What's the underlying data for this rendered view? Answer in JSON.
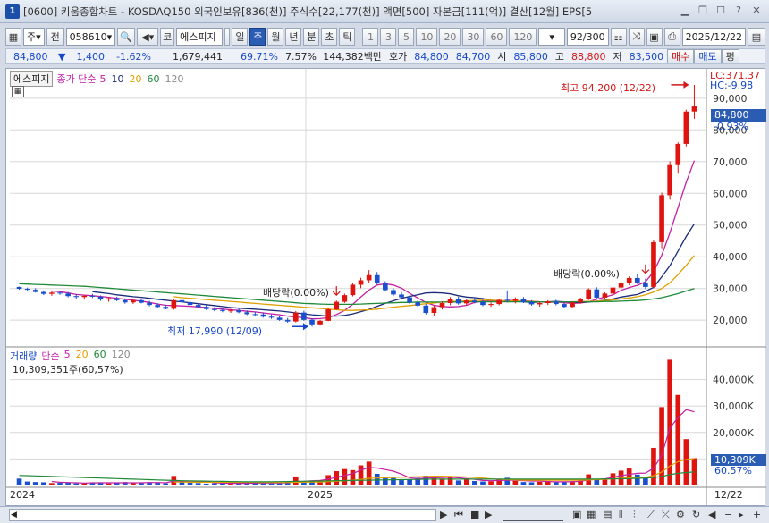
{
  "window": {
    "title": "[0600] 키움종합차트 - KOSDAQ150 외국인보유[836(천)] 주식수[22,177(천)] 액면[500] 자본금[111(억)] 결산[12월] EPS[5",
    "icon_label": "1"
  },
  "toolbar": {
    "period_kind": "주",
    "adj_label": "전",
    "code": "058610",
    "market_label": "코",
    "stock_name": "에스피지",
    "periods": [
      "일",
      "주",
      "월",
      "년",
      "분",
      "초",
      "틱"
    ],
    "selected_period": "주",
    "intervals": [
      "1",
      "3",
      "5",
      "10",
      "20",
      "30",
      "60",
      "120"
    ],
    "count": "92/300",
    "date": "2025/12/22"
  },
  "infobar": {
    "price": "84,800",
    "change_arrow": "▼",
    "change": "1,400",
    "change_pct": "-1.62%",
    "volume": "1,679,441",
    "vol_ratio": "69.71%",
    "turnover": "7.57%",
    "amount": "144,382백만",
    "ask_label": "호가",
    "ask1": "84,800",
    "ask2": "84,700",
    "open_label": "시",
    "open": "85,800",
    "high_label": "고",
    "high": "88,800",
    "low_label": "저",
    "low": "83,500",
    "buy_label": "매수",
    "sell_label": "매도",
    "eval_label": "평"
  },
  "price_legend": {
    "name": "에스피지",
    "ma_label": "종가 단순",
    "periods": [
      "5",
      "10",
      "20",
      "60",
      "120"
    ],
    "colors": [
      "#c41fa2",
      "#1c2a7a",
      "#e0a000",
      "#1f8a3a",
      "#888888"
    ]
  },
  "vol_legend": {
    "name": "거래량",
    "ma_label": "단순",
    "periods": [
      "5",
      "20",
      "60",
      "120"
    ],
    "value_text": "10,309,351주(60,57%)"
  },
  "annotations": {
    "lc": "LC:371.37",
    "hc": "HC:-9.98",
    "high_note": "최고 94,200 (12/22)",
    "low_note": "최저 17,990 (12/09)",
    "div1": "배당락(0.00%)",
    "div2": "배당락(0.00%)",
    "current_price": "84,800",
    "current_pct": "-0.93%",
    "current_vol": "10,309K",
    "current_vol_pct": "60.57%"
  },
  "date_labels": {
    "start": "2024",
    "mid": "2025",
    "end": "12/22"
  },
  "chart_data": {
    "type": "candlestick",
    "price_ylim": [
      13000,
      97000
    ],
    "price_ticks": [
      20000,
      30000,
      40000,
      50000,
      60000,
      70000,
      80000,
      90000
    ],
    "price_tick_labels": [
      "20,000",
      "30,000",
      "40,000",
      "50,000",
      "60,000",
      "70,000",
      "80,000",
      "90,000"
    ],
    "volume_ylim": [
      0,
      50000000
    ],
    "volume_ticks": [
      10000000,
      20000000,
      30000000,
      40000000
    ],
    "volume_tick_labels": [
      "10,000K",
      "20,000K",
      "30,000K",
      "40,000K"
    ],
    "candles": [
      [
        30500,
        30600,
        29600,
        29900
      ],
      [
        29900,
        30300,
        29100,
        29600
      ],
      [
        29600,
        30100,
        28700,
        28900
      ],
      [
        28900,
        29400,
        27900,
        28300
      ],
      [
        28300,
        29100,
        27700,
        28700
      ],
      [
        28700,
        29300,
        28000,
        28400
      ],
      [
        28400,
        28900,
        27200,
        27600
      ],
      [
        27600,
        28200,
        26800,
        27300
      ],
      [
        27300,
        28000,
        26500,
        27700
      ],
      [
        27700,
        28300,
        27000,
        27400
      ],
      [
        27400,
        27800,
        26100,
        26500
      ],
      [
        26500,
        27300,
        25800,
        26900
      ],
      [
        26900,
        27400,
        26000,
        26300
      ],
      [
        26300,
        26900,
        25200,
        25600
      ],
      [
        25600,
        26700,
        25100,
        26300
      ],
      [
        26300,
        26800,
        25300,
        25500
      ],
      [
        25500,
        26100,
        24400,
        24800
      ],
      [
        24800,
        25400,
        23800,
        24200
      ],
      [
        24200,
        24900,
        23400,
        23600
      ],
      [
        23600,
        26800,
        23300,
        26300
      ],
      [
        26300,
        27200,
        25300,
        25700
      ],
      [
        25700,
        26300,
        24500,
        24800
      ],
      [
        24800,
        25300,
        23800,
        24200
      ],
      [
        24200,
        24700,
        23200,
        23500
      ],
      [
        23500,
        24100,
        22800,
        23200
      ],
      [
        23200,
        23800,
        22500,
        22900
      ],
      [
        22900,
        23600,
        22300,
        23100
      ],
      [
        23100,
        23600,
        22200,
        22500
      ],
      [
        22500,
        23100,
        21600,
        21900
      ],
      [
        21900,
        22600,
        21200,
        21800
      ],
      [
        21800,
        22400,
        20800,
        21100
      ],
      [
        21100,
        21800,
        20400,
        20800
      ],
      [
        20800,
        21400,
        19800,
        20100
      ],
      [
        20100,
        20700,
        19200,
        19600
      ],
      [
        19600,
        22900,
        19300,
        22400
      ],
      [
        22400,
        23000,
        19800,
        20100
      ],
      [
        20100,
        20600,
        17990,
        18700
      ],
      [
        18700,
        20100,
        18300,
        19800
      ],
      [
        19800,
        23800,
        19700,
        23400
      ],
      [
        23400,
        26200,
        23200,
        25800
      ],
      [
        25800,
        28400,
        25400,
        27900
      ],
      [
        27900,
        31600,
        27500,
        31200
      ],
      [
        31200,
        33400,
        30100,
        32600
      ],
      [
        32600,
        35800,
        31700,
        34200
      ],
      [
        34200,
        35200,
        31300,
        31800
      ],
      [
        31800,
        32300,
        29200,
        29500
      ],
      [
        29500,
        30100,
        27600,
        28100
      ],
      [
        28100,
        28900,
        26800,
        27200
      ],
      [
        27200,
        27800,
        25100,
        25600
      ],
      [
        25600,
        26200,
        24200,
        24600
      ],
      [
        24600,
        25100,
        21800,
        22300
      ],
      [
        22300,
        24600,
        21500,
        24100
      ],
      [
        24100,
        25900,
        23400,
        25400
      ],
      [
        25400,
        27300,
        24700,
        26800
      ],
      [
        26800,
        27400,
        24900,
        25300
      ],
      [
        25300,
        26600,
        24700,
        26200
      ],
      [
        26200,
        27000,
        25300,
        25700
      ],
      [
        25700,
        26400,
        24400,
        24800
      ],
      [
        24800,
        25600,
        24200,
        25100
      ],
      [
        25100,
        26800,
        24700,
        26400
      ],
      [
        26400,
        29400,
        25600,
        26100
      ],
      [
        26100,
        27200,
        25300,
        26800
      ],
      [
        26800,
        27300,
        25400,
        25700
      ],
      [
        25700,
        26300,
        24600,
        25000
      ],
      [
        25000,
        25800,
        24300,
        25400
      ],
      [
        25400,
        26300,
        24800,
        25900
      ],
      [
        25900,
        26400,
        24700,
        25100
      ],
      [
        25100,
        25700,
        23700,
        24200
      ],
      [
        24200,
        25900,
        23800,
        25600
      ],
      [
        25600,
        27100,
        25200,
        26700
      ],
      [
        26700,
        30100,
        26300,
        29700
      ],
      [
        29700,
        30400,
        26700,
        27100
      ],
      [
        27100,
        28800,
        26600,
        28400
      ],
      [
        28400,
        30900,
        27900,
        30300
      ],
      [
        30300,
        32400,
        29600,
        31800
      ],
      [
        31800,
        33800,
        31000,
        33300
      ],
      [
        33300,
        34600,
        31400,
        31900
      ],
      [
        31900,
        33100,
        29800,
        30500
      ],
      [
        30500,
        45200,
        30100,
        44600
      ],
      [
        44600,
        60200,
        42700,
        59400
      ],
      [
        59400,
        70100,
        58000,
        68900
      ],
      [
        68900,
        76100,
        66200,
        75600
      ],
      [
        75600,
        86400,
        74800,
        85800
      ],
      [
        85800,
        94200,
        83500,
        87400
      ]
    ],
    "volumes": [
      2600000,
      1500000,
      1300000,
      1200000,
      900000,
      1000000,
      1100000,
      800000,
      900000,
      1000000,
      1200000,
      800000,
      900000,
      1300000,
      900000,
      1100000,
      1200000,
      1000000,
      800000,
      3600000,
      1500000,
      1000000,
      900000,
      700000,
      800000,
      900000,
      800000,
      700000,
      900000,
      1000000,
      900000,
      800000,
      1100000,
      1400000,
      3400000,
      1300000,
      1800000,
      1500000,
      3900000,
      5400000,
      6200000,
      5800000,
      7600000,
      9000000,
      4400000,
      3100000,
      2800000,
      2000000,
      2400000,
      2900000,
      3700000,
      3300000,
      2600000,
      3100000,
      1900000,
      2300000,
      1700000,
      1500000,
      1600000,
      2200000,
      2900000,
      1800000,
      1300000,
      1200000,
      1400000,
      1700000,
      1300000,
      1200000,
      1600000,
      2100000,
      4200000,
      2300000,
      2500000,
      4600000,
      5600000,
      6400000,
      4100000,
      3200000,
      14200000,
      29600000,
      47500000,
      34200000,
      17500000,
      10309351
    ],
    "ma_price": {
      "5": [
        null,
        null,
        null,
        null,
        29200,
        29000,
        28600,
        28100,
        27900,
        27700,
        27500,
        27200,
        26900,
        26600,
        26300,
        26000,
        25600,
        25100,
        24700,
        24600,
        24500,
        24400,
        24200,
        24000,
        23700,
        23500,
        23300,
        23100,
        22800,
        22600,
        22300,
        22000,
        21700,
        21300,
        21000,
        20800,
        20400,
        20500,
        20800,
        21800,
        23100,
        25000,
        27300,
        29500,
        31100,
        31500,
        31100,
        30100,
        28500,
        27000,
        25600,
        24700,
        24300,
        24200,
        24300,
        24700,
        25600,
        26000,
        25900,
        25800,
        26300,
        26100,
        26100,
        26000,
        25800,
        25600,
        25700,
        25500,
        25300,
        25400,
        25800,
        26600,
        27300,
        28000,
        29400,
        30300,
        31000,
        32100,
        35300,
        40500,
        47600,
        55500,
        63500,
        70300
      ],
      "10": [
        null,
        null,
        null,
        null,
        null,
        null,
        null,
        null,
        null,
        29000,
        28700,
        28400,
        28000,
        27700,
        27400,
        27200,
        26900,
        26600,
        26300,
        26000,
        25800,
        25500,
        25200,
        24900,
        24600,
        24300,
        24000,
        23800,
        23600,
        23500,
        23300,
        23100,
        22900,
        22600,
        22300,
        22000,
        21700,
        21500,
        21300,
        21300,
        21500,
        22000,
        22700,
        23400,
        24400,
        25300,
        26100,
        26900,
        27500,
        28000,
        28600,
        28700,
        28600,
        28300,
        27700,
        27300,
        27100,
        26800,
        26300,
        26000,
        25900,
        26000,
        25800,
        25600,
        25700,
        25800,
        25900,
        25800,
        25600,
        25600,
        25700,
        26000,
        26300,
        26700,
        27300,
        27700,
        28100,
        29100,
        30400,
        33700,
        37200,
        41800,
        46400,
        50400
      ],
      "20": [
        null,
        null,
        null,
        null,
        null,
        null,
        null,
        null,
        null,
        null,
        null,
        null,
        null,
        null,
        null,
        null,
        null,
        null,
        null,
        27400,
        27100,
        26900,
        26700,
        26500,
        26300,
        26100,
        25900,
        25700,
        25500,
        25300,
        25100,
        24900,
        24700,
        24500,
        24300,
        24100,
        23900,
        23700,
        23500,
        23300,
        23100,
        23100,
        23200,
        23300,
        23500,
        23800,
        24100,
        24400,
        24600,
        24900,
        25200,
        25400,
        25700,
        25900,
        26000,
        26100,
        26200,
        26300,
        26300,
        26200,
        26100,
        26100,
        26000,
        25900,
        25800,
        25800,
        25800,
        25800,
        25800,
        25900,
        25900,
        26000,
        26200,
        26400,
        26700,
        27000,
        27400,
        28000,
        28900,
        30000,
        31800,
        34400,
        37300,
        40400
      ],
      "60": [
        31500,
        31400,
        31300,
        31200,
        31100,
        31000,
        30900,
        30800,
        30700,
        30500,
        30300,
        30100,
        29900,
        29700,
        29500,
        29300,
        29100,
        28900,
        28700,
        28500,
        28300,
        28100,
        27900,
        27700,
        27500,
        27300,
        27100,
        26900,
        26700,
        26500,
        26300,
        26100,
        25900,
        25700,
        25500,
        25300,
        25200,
        25100,
        25000,
        25000,
        25000,
        25000,
        25100,
        25200,
        25300,
        25400,
        25500,
        25600,
        25600,
        25700,
        25700,
        25700,
        25700,
        25700,
        25700,
        25800,
        25800,
        25800,
        25800,
        25800,
        25800,
        25800,
        25800,
        25800,
        25800,
        25800,
        25800,
        25800,
        25800,
        25800,
        25800,
        25800,
        25900,
        25900,
        26000,
        26100,
        26200,
        26400,
        26700,
        27100,
        27700,
        28400,
        29200,
        30000
      ]
    },
    "ma_volume": {
      "5": [
        null,
        null,
        null,
        null,
        1500000,
        1200000,
        1100000,
        1000000,
        900000,
        1000000,
        1000000,
        1000000,
        1000000,
        1000000,
        1000000,
        1000000,
        1100000,
        1100000,
        1000000,
        1700000,
        1600000,
        1600000,
        1600000,
        1500000,
        1000000,
        900000,
        800000,
        800000,
        800000,
        900000,
        900000,
        900000,
        900000,
        1000000,
        1500000,
        1600000,
        1800000,
        1900000,
        2400000,
        3100000,
        3800000,
        4500000,
        5800000,
        6800000,
        6600000,
        6000000,
        5400000,
        4300000,
        2900000,
        2600000,
        2800000,
        2900000,
        3000000,
        3100000,
        2900000,
        2600000,
        2300000,
        1900000,
        1800000,
        1900000,
        2000000,
        2000000,
        1800000,
        1700000,
        1700000,
        1500000,
        1400000,
        1400000,
        1400000,
        1600000,
        2100000,
        2300000,
        2500000,
        3100000,
        3800000,
        4200000,
        4600000,
        4700000,
        6500000,
        11500000,
        21700000,
        25700000,
        28600000,
        27800000
      ],
      "20": [
        null,
        null,
        null,
        null,
        null,
        null,
        null,
        null,
        null,
        null,
        null,
        null,
        null,
        null,
        null,
        null,
        null,
        null,
        null,
        1300000,
        1300000,
        1200000,
        1200000,
        1200000,
        1200000,
        1200000,
        1200000,
        1200000,
        1200000,
        1200000,
        1100000,
        1100000,
        1100000,
        1100000,
        1200000,
        1200000,
        1300000,
        1300000,
        1500000,
        1600000,
        1800000,
        2000000,
        2300000,
        2700000,
        2800000,
        2900000,
        3000000,
        3100000,
        3200000,
        3300000,
        3400000,
        3500000,
        3500000,
        3400000,
        3300000,
        3200000,
        3000000,
        2800000,
        2500000,
        2300000,
        2200000,
        2100000,
        2000000,
        2000000,
        2000000,
        2000000,
        2000000,
        2000000,
        2000000,
        2000000,
        2100000,
        2200000,
        2300000,
        2500000,
        2700000,
        2900000,
        3000000,
        3100000,
        3700000,
        5100000,
        7400000,
        9000000,
        9800000,
        10200000
      ],
      "60": [
        3800000,
        3700000,
        3600000,
        3500000,
        3400000,
        3300000,
        3200000,
        3100000,
        3000000,
        2900000,
        2800000,
        2700000,
        2600000,
        2500000,
        2400000,
        2300000,
        2200000,
        2100000,
        2000000,
        1900000,
        1800000,
        1750000,
        1700000,
        1650000,
        1600000,
        1550000,
        1500000,
        1450000,
        1400000,
        1400000,
        1400000,
        1400000,
        1450000,
        1500000,
        1550000,
        1600000,
        1650000,
        1700000,
        1750000,
        1800000,
        1850000,
        1900000,
        1950000,
        2000000,
        2050000,
        2100000,
        2150000,
        2200000,
        2250000,
        2300000,
        2350000,
        2400000,
        2400000,
        2400000,
        2400000,
        2400000,
        2400000,
        2400000,
        2400000,
        2400000,
        2400000,
        2400000,
        2400000,
        2400000,
        2400000,
        2400000,
        2400000,
        2400000,
        2400000,
        2400000,
        2400000,
        2400000,
        2450000,
        2500000,
        2550000,
        2600000,
        2700000,
        2800000,
        3000000,
        3400000,
        4100000,
        4600000,
        4900000,
        5100000
      ]
    },
    "xaxis_labels": [
      "2024",
      "2025",
      "12/22"
    ]
  }
}
